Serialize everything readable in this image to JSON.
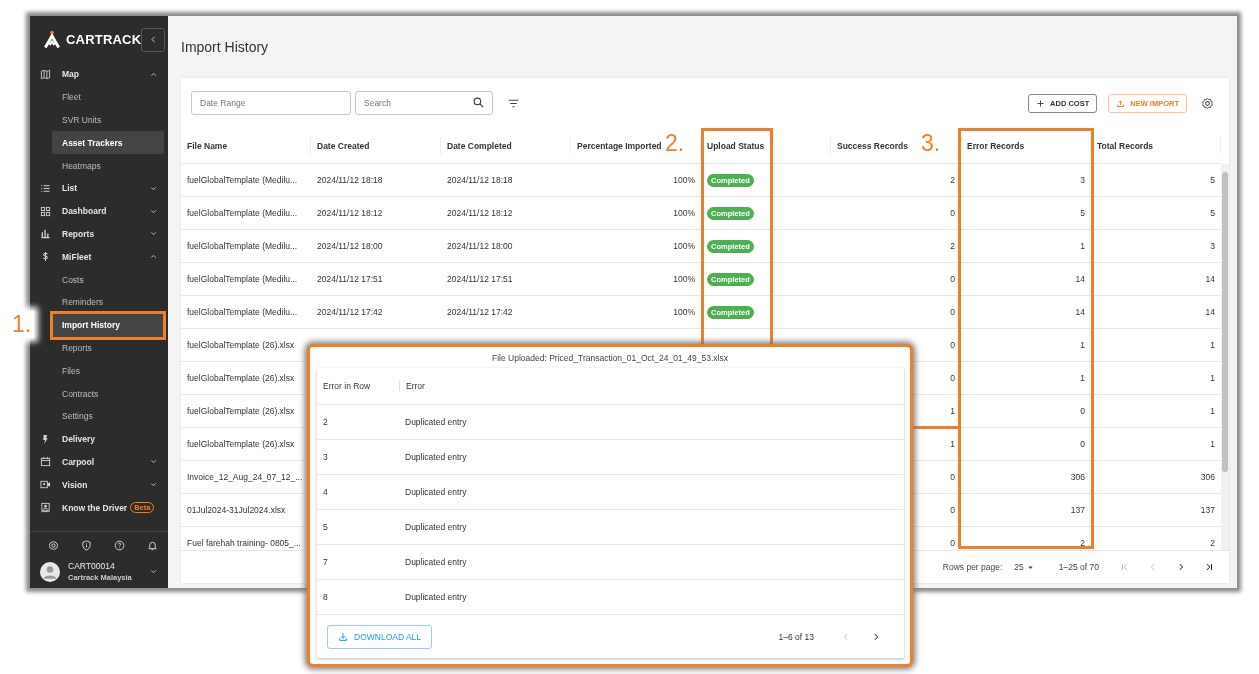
{
  "annotations": [
    {
      "label": "1."
    },
    {
      "label": "2."
    },
    {
      "label": "3."
    }
  ],
  "sidebar": {
    "logo": "CARTRACK",
    "items": [
      {
        "label": "Map",
        "expanded": true,
        "children": [
          {
            "label": "Fleet",
            "selected": false
          },
          {
            "label": "SVR Units",
            "selected": false
          },
          {
            "label": "Asset Trackers",
            "selected": true
          },
          {
            "label": "Heatmaps",
            "selected": false
          }
        ]
      },
      {
        "label": "List",
        "expanded": false
      },
      {
        "label": "Dashboard",
        "expanded": false
      },
      {
        "label": "Reports",
        "expanded": false
      },
      {
        "label": "MiFleet",
        "expanded": true,
        "children": [
          {
            "label": "Costs",
            "selected": false
          },
          {
            "label": "Reminders",
            "selected": false
          },
          {
            "label": "Import History",
            "selected": true
          },
          {
            "label": "Reports",
            "selected": false
          },
          {
            "label": "Files",
            "selected": false
          },
          {
            "label": "Contracts",
            "selected": false
          },
          {
            "label": "Settings",
            "selected": false
          }
        ]
      },
      {
        "label": "Delivery"
      },
      {
        "label": "Carpool",
        "expanded": false
      },
      {
        "label": "Vision",
        "expanded": false
      },
      {
        "label": "Know the Driver",
        "badge": "Beta"
      }
    ],
    "user": {
      "name": "CART00014",
      "company": "Cartrack Malaysia"
    }
  },
  "page": {
    "title": "Import History",
    "date_range": {
      "placeholder": "Date Range"
    },
    "search": {
      "placeholder": "Search"
    },
    "buttons": [
      {
        "label": "ADD COST",
        "kind": "add"
      },
      {
        "label": "NEW IMPORT",
        "kind": "import"
      }
    ]
  },
  "table": {
    "columns": [
      "File Name",
      "Date Created",
      "Date Completed",
      "Percentage Imported",
      "Upload Status",
      "Success Records",
      "Error Records",
      "Total Records"
    ],
    "rows": [
      {
        "file_name": "fuelGlobalTemplate (Medilu...",
        "date_created": "2024/11/12 18:18",
        "date_completed": "2024/11/12 18:18",
        "percentage": "100%",
        "status": "Completed",
        "success": "2",
        "errors": "3",
        "total": "5"
      },
      {
        "file_name": "fuelGlobalTemplate (Medilu...",
        "date_created": "2024/11/12 18:12",
        "date_completed": "2024/11/12 18:12",
        "percentage": "100%",
        "status": "Completed",
        "success": "0",
        "errors": "5",
        "total": "5"
      },
      {
        "file_name": "fuelGlobalTemplate (Medilu...",
        "date_created": "2024/11/12 18:00",
        "date_completed": "2024/11/12 18:00",
        "percentage": "100%",
        "status": "Completed",
        "success": "2",
        "errors": "1",
        "total": "3"
      },
      {
        "file_name": "fuelGlobalTemplate (Medilu...",
        "date_created": "2024/11/12 17:51",
        "date_completed": "2024/11/12 17:51",
        "percentage": "100%",
        "status": "Completed",
        "success": "0",
        "errors": "14",
        "total": "14"
      },
      {
        "file_name": "fuelGlobalTemplate (Medilu...",
        "date_created": "2024/11/12 17:42",
        "date_completed": "2024/11/12 17:42",
        "percentage": "100%",
        "status": "Completed",
        "success": "0",
        "errors": "14",
        "total": "14"
      },
      {
        "file_name": "fuelGlobalTemplate (26).xlsx",
        "success": "0",
        "errors": "1",
        "total": "1"
      },
      {
        "file_name": "fuelGlobalTemplate (26).xlsx",
        "success": "0",
        "errors": "1",
        "total": "1"
      },
      {
        "file_name": "fuelGlobalTemplate (26).xlsx",
        "success": "1",
        "errors": "0",
        "total": "1"
      },
      {
        "file_name": "fuelGlobalTemplate (26).xlsx",
        "success": "1",
        "errors": "0",
        "total": "1"
      },
      {
        "file_name": "Invoice_12_Aug_24_07_12_...",
        "success": "0",
        "errors": "306",
        "total": "306"
      },
      {
        "file_name": "01Jul2024-31Jul2024.xlsx",
        "success": "0",
        "errors": "137",
        "total": "137"
      },
      {
        "file_name": "Fuel farehah training- 0805_...",
        "success": "0",
        "errors": "2",
        "total": "2"
      }
    ]
  },
  "pagination": {
    "rows_per_page_label": "Rows per page:",
    "rows_per_page": "25",
    "range": "1–25 of 70",
    "buttons": [
      {
        "kind": "first",
        "disabled": true
      },
      {
        "kind": "prev",
        "disabled": true
      },
      {
        "kind": "next",
        "disabled": false
      },
      {
        "kind": "last",
        "disabled": false
      }
    ]
  },
  "error_dialog": {
    "title": "File Uploaded: Priced_Transaction_01_Oct_24_01_49_53.xlsx",
    "columns": [
      "Error in Row",
      "Error"
    ],
    "rows": [
      {
        "row": "2",
        "error": "Duplicated entry"
      },
      {
        "row": "3",
        "error": "Duplicated entry"
      },
      {
        "row": "4",
        "error": "Duplicated entry"
      },
      {
        "row": "5",
        "error": "Duplicated entry"
      },
      {
        "row": "7",
        "error": "Duplicated entry"
      },
      {
        "row": "8",
        "error": "Duplicated entry"
      }
    ],
    "download_button": "DOWNLOAD ALL",
    "range": "1–6 of 13",
    "pager": [
      {
        "kind": "prev",
        "disabled": true
      },
      {
        "kind": "next",
        "disabled": false
      }
    ]
  }
}
